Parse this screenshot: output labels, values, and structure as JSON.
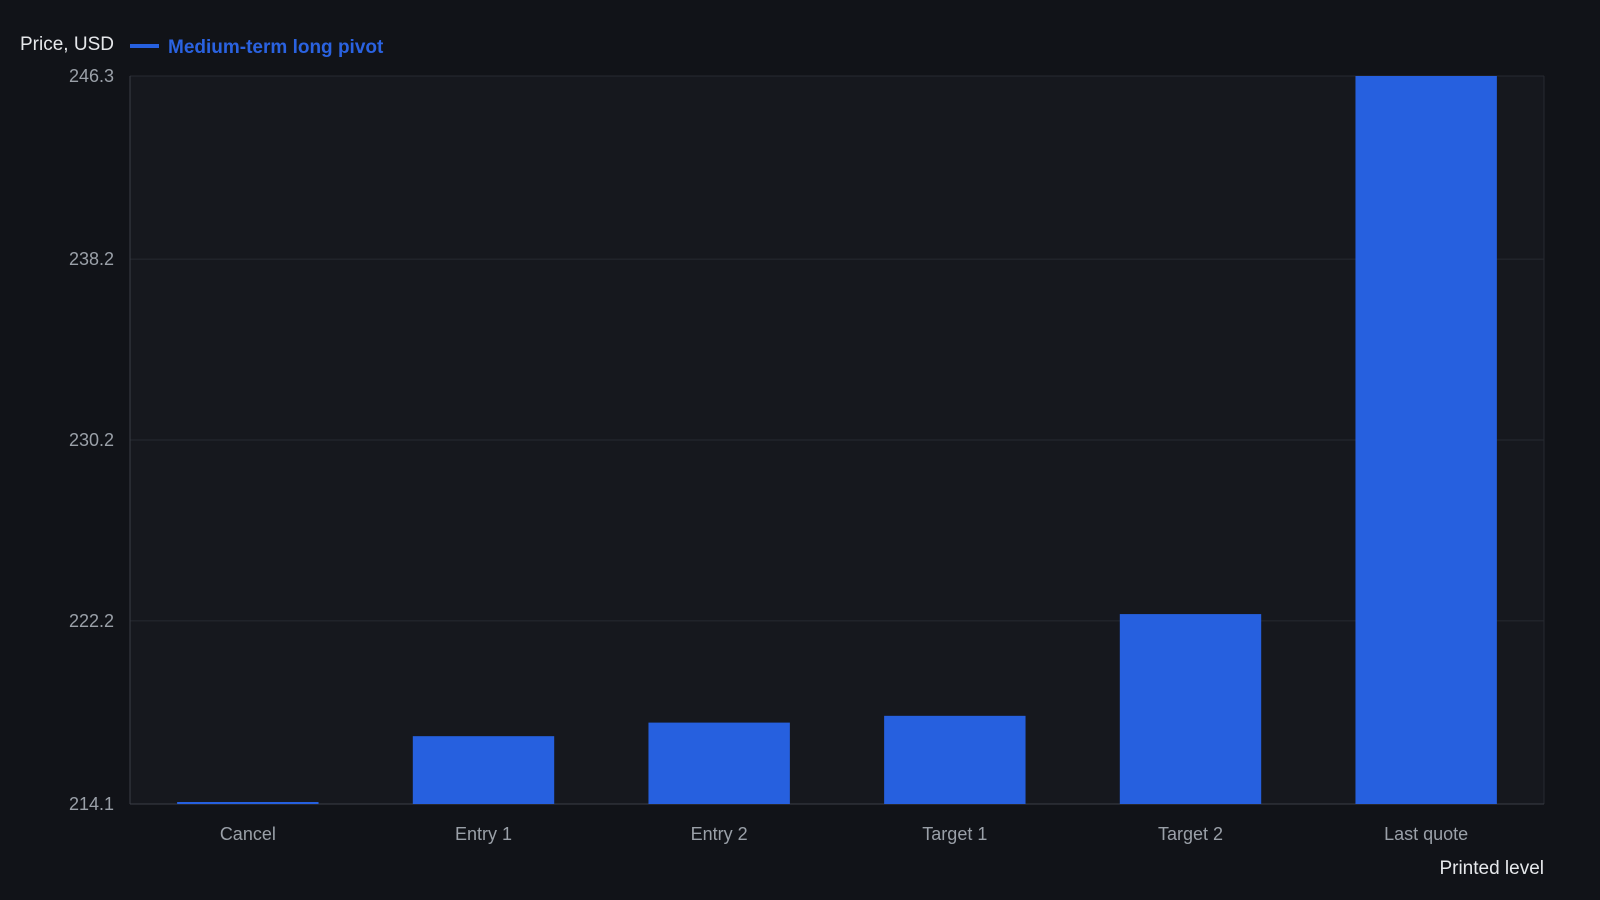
{
  "chart_data": {
    "type": "bar",
    "ylabel": "Price, USD",
    "xlabel": "Printed level",
    "categories": [
      "Cancel",
      "Entry 1",
      "Entry 2",
      "Target 1",
      "Target 2",
      "Last quote"
    ],
    "series": [
      {
        "name": "Medium-term long pivot",
        "values": [
          214.1,
          217.1,
          217.7,
          218.0,
          222.5,
          246.3
        ]
      }
    ],
    "yticks": [
      "214.1",
      "222.2",
      "230.2",
      "238.2",
      "246.3"
    ],
    "ylim": [
      214.1,
      246.3
    ],
    "grid": true,
    "legend_position": "top-left"
  },
  "colors": {
    "background": "#111318",
    "plot_background": "#16181e",
    "bar": "#2660df",
    "grid": "#262a31",
    "axis": "#3a3e46",
    "tick_text": "#9aa0a8",
    "title_text": "#e6e8eb"
  }
}
